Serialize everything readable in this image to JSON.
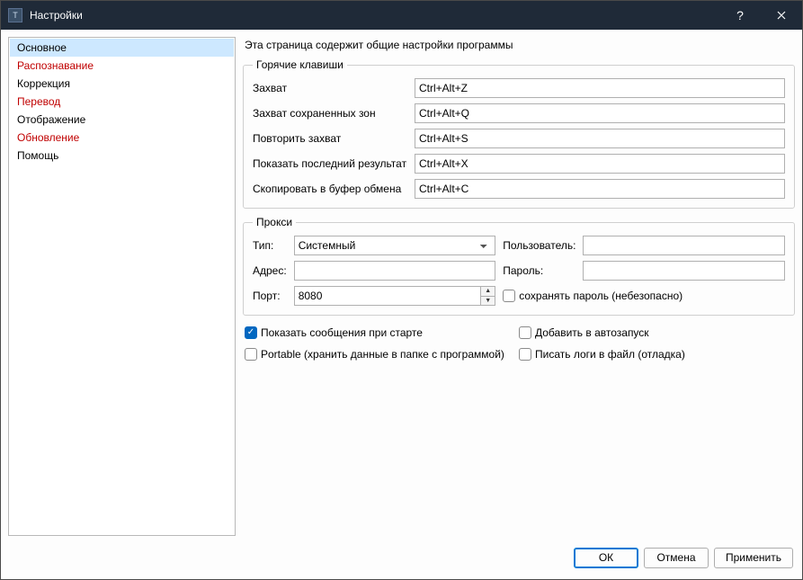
{
  "window": {
    "title": "Настройки"
  },
  "sidebar": {
    "items": [
      {
        "label": "Основное",
        "selected": true,
        "red": false
      },
      {
        "label": "Распознавание",
        "selected": false,
        "red": true
      },
      {
        "label": "Коррекция",
        "selected": false,
        "red": false
      },
      {
        "label": "Перевод",
        "selected": false,
        "red": true
      },
      {
        "label": "Отображение",
        "selected": false,
        "red": false
      },
      {
        "label": "Обновление",
        "selected": false,
        "red": true
      },
      {
        "label": "Помощь",
        "selected": false,
        "red": false
      }
    ]
  },
  "main": {
    "description": "Эта страница содержит общие настройки программы",
    "hotkeys": {
      "legend": "Горячие клавиши",
      "rows": [
        {
          "label": "Захват",
          "value": "Ctrl+Alt+Z"
        },
        {
          "label": "Захват сохраненных зон",
          "value": "Ctrl+Alt+Q"
        },
        {
          "label": "Повторить захват",
          "value": "Ctrl+Alt+S"
        },
        {
          "label": "Показать последний результат",
          "value": "Ctrl+Alt+X"
        },
        {
          "label": "Скопировать в буфер обмена",
          "value": "Ctrl+Alt+C"
        }
      ]
    },
    "proxy": {
      "legend": "Прокси",
      "type_label": "Тип:",
      "type_value": "Системный",
      "user_label": "Пользователь:",
      "user_value": "",
      "addr_label": "Адрес:",
      "addr_value": "",
      "pass_label": "Пароль:",
      "pass_value": "",
      "port_label": "Порт:",
      "port_value": "8080",
      "save_pass_label": "сохранять пароль (небезопасно)",
      "save_pass_checked": false
    },
    "checks": {
      "show_start": {
        "label": "Показать сообщения при старте",
        "checked": true
      },
      "autostart": {
        "label": "Добавить в автозапуск",
        "checked": false
      },
      "portable": {
        "label": "Portable (хранить данные в папке с программой)",
        "checked": false
      },
      "write_logs": {
        "label": "Писать логи в файл (отладка)",
        "checked": false
      }
    }
  },
  "footer": {
    "ok": "ОК",
    "cancel": "Отмена",
    "apply": "Применить"
  }
}
